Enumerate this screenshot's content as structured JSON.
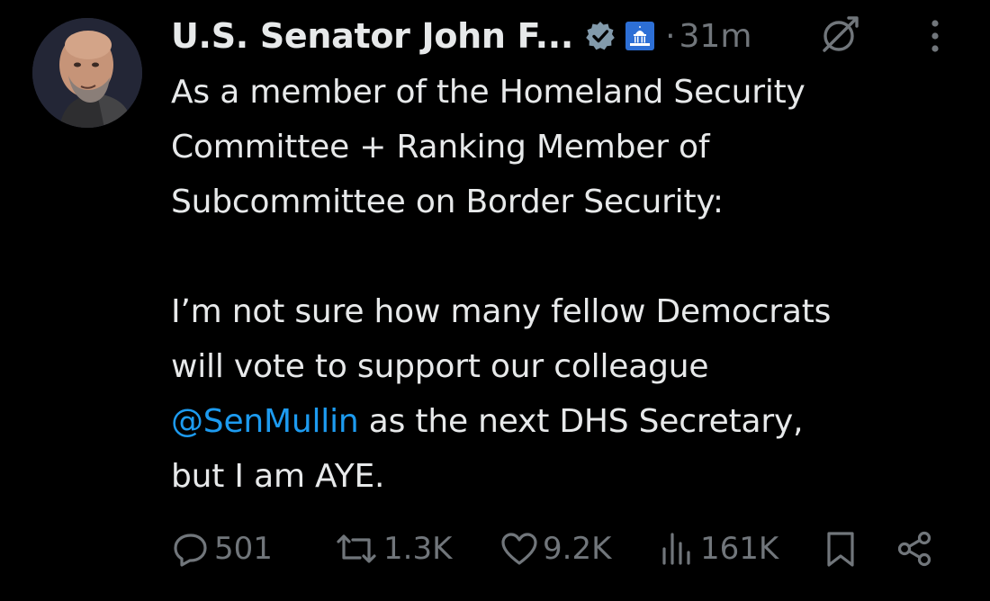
{
  "author": {
    "display_name": "U.S. Senator John F...",
    "verified_icon": "verified-badge-icon",
    "affiliation_icon": "capitol-building-icon",
    "dot": "·",
    "time": "31m"
  },
  "tweet": {
    "paragraph1": [
      "As a member of the Homeland Security",
      "Committee + Ranking Member of",
      "Subcommittee on Border Security:"
    ],
    "paragraph2": [
      "I’m not sure how many fellow Democrats",
      "will vote to support our colleague"
    ],
    "mention": "@SenMullin",
    "mention_suffix": " as the next DHS Secretary,",
    "last_line": "but I am AYE."
  },
  "actions": {
    "replies": "501",
    "reposts": "1.3K",
    "likes": "9.2K",
    "views": "161K"
  },
  "colors": {
    "background": "#000000",
    "text": "#e7e9ea",
    "muted": "#71767b",
    "link": "#1d9bf0",
    "verified_badge": "#829aab"
  }
}
